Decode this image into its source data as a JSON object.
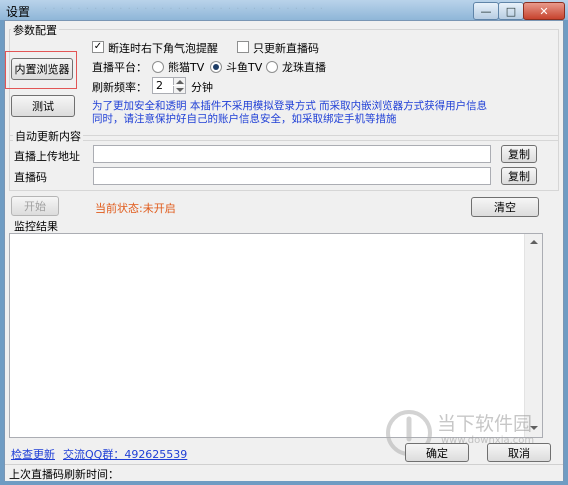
{
  "window": {
    "title": "设置",
    "title_faded": "· · · · · · · · · · · · · · · · · · · · · · · · · · · · · · · · · ·",
    "minimize_symbol": "—",
    "maximize_symbol": "□",
    "close_symbol": "✕"
  },
  "params": {
    "legend": "参数配置",
    "builtin_browser_button": "内置浏览器",
    "test_button": "测试",
    "disconnect_notify_label": "断连时右下角气泡提醒",
    "disconnect_notify_checked": true,
    "only_update_code_label": "只更新直播码",
    "only_update_code_checked": false,
    "platform_label": "直播平台：",
    "platforms": [
      {
        "label": "熊猫TV",
        "selected": false
      },
      {
        "label": "斗鱼TV",
        "selected": true
      },
      {
        "label": "龙珠直播",
        "selected": false
      }
    ],
    "refresh_label": "刷新频率：",
    "refresh_value": "2",
    "refresh_unit": "分钟",
    "notice_line1": "为了更加安全和透明  本插件不采用模拟登录方式  而采取内嵌浏览器方式获得用户信息",
    "notice_line2": "同时，请注意保护好自己的账户信息安全，如采取绑定手机等措施"
  },
  "auto_update": {
    "legend": "自动更新内容",
    "upload_url_label": "直播上传地址",
    "upload_url_value": "",
    "stream_code_label": "直播码",
    "stream_code_value": "",
    "copy_button": "复制"
  },
  "controls": {
    "start_button": "开始",
    "status_text": "当前状态:未开启",
    "clear_button": "清空"
  },
  "monitor": {
    "label": "监控结果",
    "content": ""
  },
  "footer": {
    "check_update_link": "检查更新",
    "qq_group_link": "交流QQ群：492625539",
    "ok_button": "确定",
    "cancel_button": "取消",
    "status_text": "上次直播码刷新时间："
  },
  "watermark": {
    "name": "当下软件园",
    "url": "www.downxia.com"
  },
  "colors": {
    "notice_text": "#1f3fd6",
    "status_text": "#e05a1a",
    "highlight_box": "#e25555"
  }
}
